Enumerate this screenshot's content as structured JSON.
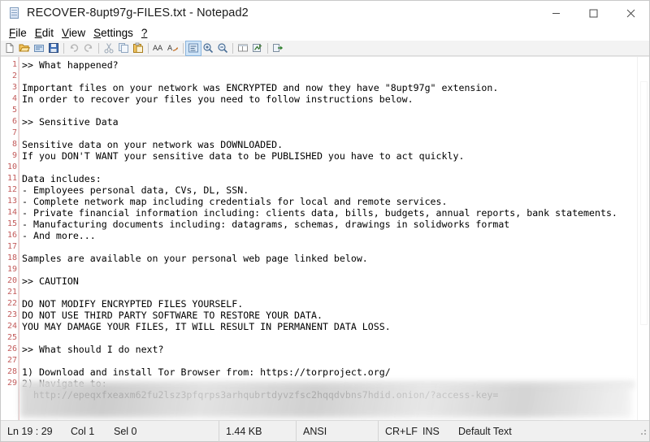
{
  "window": {
    "title": "RECOVER-8upt97g-FILES.txt - Notepad2",
    "icon": "document-icon",
    "controls": [
      {
        "name": "minimize-button",
        "glyph": "minimize-icon"
      },
      {
        "name": "maximize-button",
        "glyph": "maximize-icon"
      },
      {
        "name": "close-button",
        "glyph": "close-icon"
      }
    ]
  },
  "menubar": {
    "items": [
      {
        "name": "menu-file",
        "accel": "F",
        "rest": "ile"
      },
      {
        "name": "menu-edit",
        "accel": "E",
        "rest": "dit"
      },
      {
        "name": "menu-view",
        "accel": "V",
        "rest": "iew"
      },
      {
        "name": "menu-settings",
        "accel": "S",
        "rest": "ettings"
      },
      {
        "name": "menu-help",
        "accel": "?",
        "rest": ""
      }
    ]
  },
  "toolbar": {
    "buttons": [
      "new-file-icon",
      "open-file-icon",
      "open-recent-icon",
      "save-file-icon",
      "sep",
      "undo-icon",
      "redo-icon",
      "sep",
      "cut-icon",
      "copy-icon",
      "paste-icon",
      "sep",
      "find-icon",
      "replace-icon",
      "sep",
      "word-wrap-icon",
      "zoom-in-icon",
      "zoom-out-icon",
      "sep",
      "toggle-whitespace-icon",
      "file-encoding-icon",
      "sep",
      "launch-icon"
    ]
  },
  "editor": {
    "line_count": 29,
    "lines": [
      ">> What happened?",
      "",
      "Important files on your network was ENCRYPTED and now they have \"8upt97g\" extension.",
      "In order to recover your files you need to follow instructions below.",
      "",
      ">> Sensitive Data",
      "",
      "Sensitive data on your network was DOWNLOADED.",
      "If you DON'T WANT your sensitive data to be PUBLISHED you have to act quickly.",
      "",
      "Data includes:",
      "- Employees personal data, CVs, DL, SSN.",
      "- Complete network map including credentials for local and remote services.",
      "- Private financial information including: clients data, bills, budgets, annual reports, bank statements.",
      "- Manufacturing documents including: datagrams, schemas, drawings in solidworks format",
      "- And more...",
      "",
      "Samples are available on your personal web page linked below.",
      "",
      ">> CAUTION",
      "",
      "DO NOT MODIFY ENCRYPTED FILES YOURSELF.",
      "DO NOT USE THIRD PARTY SOFTWARE TO RESTORE YOUR DATA.",
      "YOU MAY DAMAGE YOUR FILES, IT WILL RESULT IN PERMANENT DATA LOSS.",
      "",
      ">> What should I do next?",
      "",
      "1) Download and install Tor Browser from: https://torproject.org/",
      "2) Navigate to:",
      "  http://epeqxfxeaxm62fu2lsz3pfqrps3arhqubrtdyvzfsc2hqqdvbns7hdid.onion/?access-key="
    ],
    "redacted_note": "blurred-region"
  },
  "statusbar": {
    "line_col": "Ln 19 : 29",
    "col": "Col 1",
    "sel": "Sel 0",
    "size": "1.44 KB",
    "encoding": "ANSI",
    "eol": "CR+LF",
    "insert_mode": "INS",
    "scheme": "Default Text"
  },
  "colors": {
    "line_number": "#c25a5a",
    "text": "#000000",
    "titlebar_bg": "#ffffff",
    "toolbar_bg": "#f3f3f3",
    "statusbar_bg": "#f0f0f0"
  }
}
